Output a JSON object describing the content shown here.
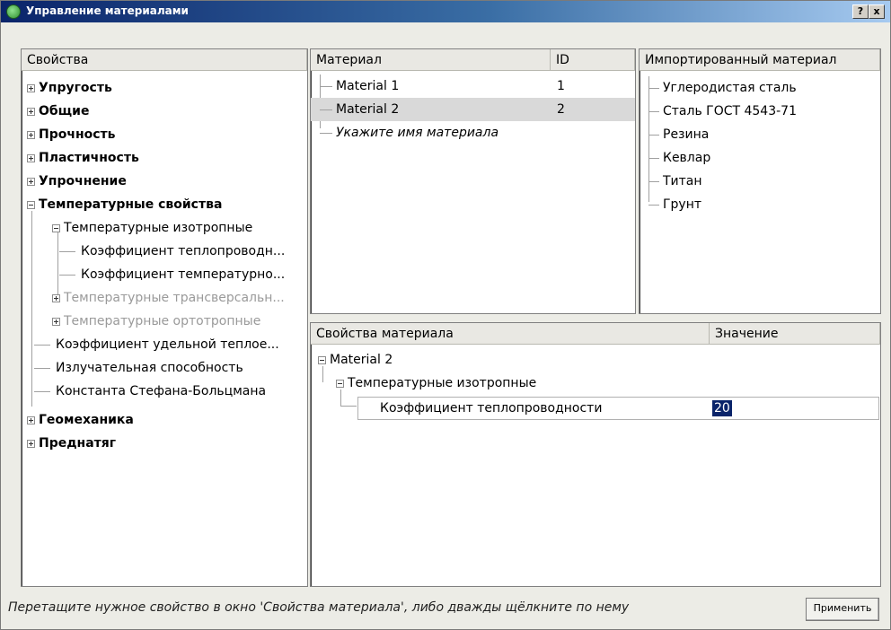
{
  "window": {
    "title": "Управление материалами",
    "help_label": "?",
    "close_label": "x"
  },
  "properties": {
    "header": "Свойства",
    "items": [
      "Упругость",
      "Общие",
      "Прочность",
      "Пластичность",
      "Упрочнение",
      "Температурные свойства",
      "Температурные изотропные",
      "Коэффициент теплопроводн...",
      "Коэффициент температурно...",
      "Температурные трансверсальн...",
      "Температурные ортотропные",
      "Коэффициент удельной теплое...",
      "Излучательная способность",
      "Константа Стефана-Больцмана",
      "Геомеханика",
      "Преднатяг"
    ]
  },
  "materials": {
    "header_name": "Материал",
    "header_id": "ID",
    "rows": [
      {
        "name": "Material 1",
        "id": "1"
      },
      {
        "name": "Material 2",
        "id": "2"
      }
    ],
    "placeholder": "Укажите имя материала"
  },
  "imported": {
    "header": "Импортированный материал",
    "items": [
      "Углеродистая сталь",
      "Сталь ГОСТ 4543-71",
      "Резина",
      "Кевлар",
      "Титан",
      "Грунт"
    ]
  },
  "material_props": {
    "header_name": "Свойства материала",
    "header_value": "Значение",
    "root": "Material 2",
    "group": "Температурные изотропные",
    "property": "Коэффициент теплопроводности",
    "value": "20"
  },
  "status": {
    "hint": "Перетащите нужное свойство в окно 'Свойства материала', либо дважды щёлкните по нему",
    "apply_label": "Применить"
  },
  "colors": {
    "title_bar": "#0a246a",
    "selection": "#d9d9d9",
    "value_highlight": "#0a246a"
  }
}
